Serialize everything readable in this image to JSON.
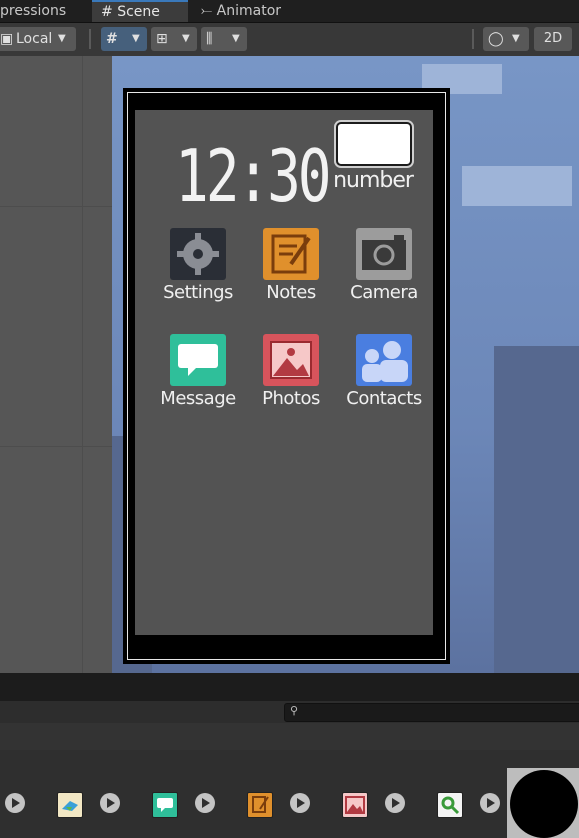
{
  "tabs": [
    {
      "label": "pressions",
      "icon": "none"
    },
    {
      "label": "Scene",
      "icon": "hash-icon"
    },
    {
      "label": "Animator",
      "icon": "animator-icon"
    }
  ],
  "toolbar": {
    "pivot_label": "Local",
    "mode_2d": "2D"
  },
  "phone": {
    "time": "12:30",
    "number_label": "number",
    "apps": [
      {
        "label": "Settings",
        "icon": "gear-icon",
        "color": "#2a2e36"
      },
      {
        "label": "Notes",
        "icon": "notes-icon",
        "color": "#e0902c"
      },
      {
        "label": "Camera",
        "icon": "camera-icon",
        "color": "#9c9c9c"
      },
      {
        "label": "Message",
        "icon": "message-icon",
        "color": "#2fbf9a"
      },
      {
        "label": "Photos",
        "icon": "photos-icon",
        "color": "#d7545c"
      },
      {
        "label": "Contacts",
        "icon": "contacts-icon",
        "color": "#4a7ee0"
      }
    ]
  },
  "bottom_panel": {
    "search_placeholder": "",
    "thumbnails": [
      "bird-thumb-icon",
      "message-thumb-icon",
      "notes-thumb-icon",
      "photos-thumb-icon",
      "magnifier-thumb-icon"
    ]
  },
  "colors": {
    "sky": "#7896c6",
    "phone_screen": "#535353",
    "active_tab_accent": "#3a79bb"
  }
}
